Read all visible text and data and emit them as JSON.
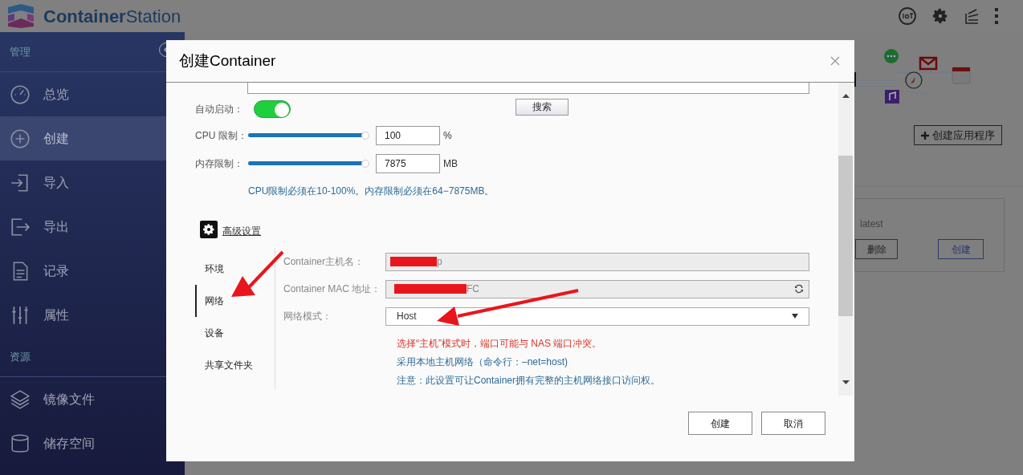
{
  "app": {
    "name_bold": "Container",
    "name_light": "Station"
  },
  "sidebar": {
    "sections": [
      {
        "title": "管理",
        "items": [
          {
            "label": "总览",
            "selected": false
          },
          {
            "label": "创建",
            "selected": true
          },
          {
            "label": "导入",
            "selected": false
          },
          {
            "label": "导出",
            "selected": false
          },
          {
            "label": "记录",
            "selected": false
          },
          {
            "label": "属性",
            "selected": false
          }
        ]
      },
      {
        "title": "资源",
        "items": [
          {
            "label": "镜像文件",
            "selected": false
          },
          {
            "label": "储存空间",
            "selected": false
          }
        ]
      }
    ]
  },
  "background": {
    "create_app_button": "创建应用程序",
    "card": {
      "tag": "latest",
      "buttons": [
        "删除",
        "创建"
      ]
    }
  },
  "dialog": {
    "title": "创建Container",
    "search_button": "搜索",
    "autostart": {
      "label": "自动启动：",
      "on": true
    },
    "limits": [
      {
        "label": "CPU 限制：",
        "level": 1,
        "value": "100",
        "unit": "%"
      },
      {
        "label": "内存限制：",
        "level": 1,
        "value": "7875",
        "unit": "MB"
      }
    ],
    "limit_note": "CPU限制必须在10-100%。内存限制必须在64−7875MB。",
    "advanced_link": "高级设置",
    "tabs": [
      {
        "label": "环境",
        "selected": false
      },
      {
        "label": "网络",
        "selected": true
      },
      {
        "label": "设备",
        "selected": false
      },
      {
        "label": "共享文件夹",
        "selected": false
      }
    ],
    "fields": [
      {
        "kind": "text",
        "label": "Container主机名：",
        "value": "p",
        "redacted": true,
        "disabled": true
      },
      {
        "kind": "refresh",
        "label": "Container MAC 地址：",
        "value": "FC",
        "redacted": true,
        "disabled": true
      },
      {
        "kind": "select",
        "label": "网络模式：",
        "value": "Host",
        "redacted": false,
        "disabled": false
      }
    ],
    "notes": [
      {
        "kind": "warning",
        "text": "选择“主机”模式时，端口可能与 NAS 端口冲突。"
      },
      {
        "kind": "info",
        "text": "采用本地主机网络（命令行：–net=host)"
      },
      {
        "kind": "info",
        "text": "注意：此设置可让Container拥有完整的主机网络接口访问权。"
      }
    ],
    "buttons": [
      "创建",
      "取消"
    ]
  }
}
